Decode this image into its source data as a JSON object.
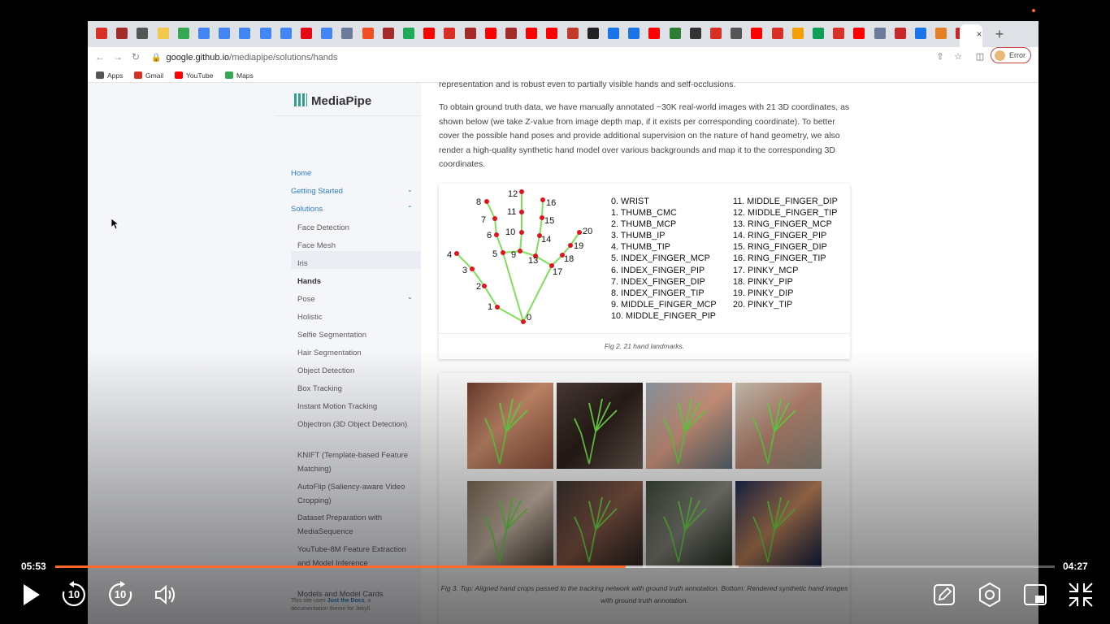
{
  "browser": {
    "tabs": [
      {
        "icon": "gmail-icon",
        "color": "#d93025"
      },
      {
        "icon": "bookmark-w-icon",
        "color": "#a52a2a"
      },
      {
        "icon": "circle-icon",
        "color": "#555555"
      },
      {
        "icon": "calendar-icon",
        "color": "#f2c94c"
      },
      {
        "icon": "drive-icon",
        "color": "#34a853"
      },
      {
        "icon": "docs-icon",
        "color": "#4285f4"
      },
      {
        "icon": "docs-icon",
        "color": "#4285f4"
      },
      {
        "icon": "docs-icon",
        "color": "#4285f4"
      },
      {
        "icon": "docs-icon",
        "color": "#4285f4"
      },
      {
        "icon": "docs-icon",
        "color": "#4285f4"
      },
      {
        "icon": "netflix-icon",
        "color": "#e50914"
      },
      {
        "icon": "docs-icon",
        "color": "#4285f4"
      },
      {
        "icon": "globe-icon",
        "color": "#6b7b9a"
      },
      {
        "icon": "windows-icon",
        "color": "#f25022"
      },
      {
        "icon": "bookmark-w-icon",
        "color": "#a52a2a"
      },
      {
        "icon": "app-icon",
        "color": "#1faa59"
      },
      {
        "icon": "youtube-icon",
        "color": "#ff0000"
      },
      {
        "icon": "mail-icon",
        "color": "#d93025"
      },
      {
        "icon": "bookmark-w-icon",
        "color": "#a52a2a"
      },
      {
        "icon": "youtube-icon",
        "color": "#ff0000"
      },
      {
        "icon": "bookmark-w-icon",
        "color": "#a52a2a"
      },
      {
        "icon": "youtube-icon",
        "color": "#ff0000"
      },
      {
        "icon": "youtube-icon",
        "color": "#ff0000"
      },
      {
        "icon": "person-icon",
        "color": "#c0392b"
      },
      {
        "icon": "github-icon",
        "color": "#222222"
      },
      {
        "icon": "k-icon",
        "color": "#1a73e8"
      },
      {
        "icon": "k-icon",
        "color": "#1a73e8"
      },
      {
        "icon": "youtube-icon",
        "color": "#ff0000"
      },
      {
        "icon": "app-icon",
        "color": "#2e7d32"
      },
      {
        "icon": "circle-icon",
        "color": "#333333"
      },
      {
        "icon": "mail-icon",
        "color": "#d93025"
      },
      {
        "icon": "cloud-icon",
        "color": "#555555"
      },
      {
        "icon": "youtube-icon",
        "color": "#ff0000"
      },
      {
        "icon": "mail-icon",
        "color": "#d93025"
      },
      {
        "icon": "link-icon",
        "color": "#f4a100"
      },
      {
        "icon": "sheet-icon",
        "color": "#0f9d58"
      },
      {
        "icon": "mail-icon",
        "color": "#d93025"
      },
      {
        "icon": "youtube-icon",
        "color": "#ff0000"
      },
      {
        "icon": "globe-icon",
        "color": "#6b7b9a"
      },
      {
        "icon": "k-red-icon",
        "color": "#c62828"
      },
      {
        "icon": "k-icon",
        "color": "#1a73e8"
      },
      {
        "icon": "pen-icon",
        "color": "#e67e22"
      },
      {
        "icon": "k-red-icon",
        "color": "#c62828"
      },
      {
        "icon": "page-icon",
        "color": "#ffffff"
      }
    ],
    "close_label": "×",
    "new_tab_label": "+",
    "url_host": "google.github.io",
    "url_path": "/mediapipe/solutions/hands",
    "error_label": "Error",
    "bookmarks": [
      {
        "label": "Apps",
        "icon": "apps-icon",
        "color": "#555555"
      },
      {
        "label": "Gmail",
        "icon": "gmail-icon",
        "color": "#d93025"
      },
      {
        "label": "YouTube",
        "icon": "youtube-icon",
        "color": "#ff0000"
      },
      {
        "label": "Maps",
        "icon": "maps-icon",
        "color": "#34a853"
      }
    ]
  },
  "sidebar": {
    "logo": "MediaPipe",
    "home": "Home",
    "getting_started": "Getting Started",
    "solutions": "Solutions",
    "items": [
      "Face Detection",
      "Face Mesh",
      "Iris",
      "Hands",
      "Pose",
      "Holistic",
      "Selfie Segmentation",
      "Hair Segmentation",
      "Object Detection",
      "Box Tracking",
      "Instant Motion Tracking",
      "Objectron (3D Object Detection)",
      "KNIFT (Template-based Feature Matching)",
      "AutoFlip (Saliency-aware Video Cropping)",
      "Dataset Preparation with MediaSequence",
      "YouTube-8M Feature Extraction and Model Inference",
      "Models and Model Cards"
    ],
    "footer_prefix": "This site uses ",
    "footer_link": "Just the Docs",
    "footer_suffix": ", a documentation theme for Jekyll."
  },
  "content": {
    "para1": "representation and is robust even to partially visible hands and self-occlusions.",
    "para2": "To obtain ground truth data, we have manually annotated ~30K real-world images with 21 3D coordinates, as shown below (we take Z-value from image depth map, if it exists per corresponding coordinate). To better cover the possible hand poses and provide additional supervision on the nature of hand geometry, we also render a high-quality synthetic hand model over various backgrounds and map it to the corresponding 3D coordinates.",
    "fig2_caption": "Fig 2. 21 hand landmarks.",
    "landmarks_col1": [
      "0. WRIST",
      "1. THUMB_CMC",
      "2. THUMB_MCP",
      "3. THUMB_IP",
      "4. THUMB_TIP",
      "5. INDEX_FINGER_MCP",
      "6. INDEX_FINGER_PIP",
      "7. INDEX_FINGER_DIP",
      "8. INDEX_FINGER_TIP",
      "9. MIDDLE_FINGER_MCP",
      "10. MIDDLE_FINGER_PIP"
    ],
    "landmarks_col2": [
      "11. MIDDLE_FINGER_DIP",
      "12. MIDDLE_FINGER_TIP",
      "13. RING_FINGER_MCP",
      "14. RING_FINGER_PIP",
      "15. RING_FINGER_DIP",
      "16. RING_FINGER_TIP",
      "17. PINKY_MCP",
      "18. PINKY_PIP",
      "19. PINKY_DIP",
      "20. PINKY_TIP"
    ],
    "fig3_caption": "Fig 3. Top: Aligned hand crops passed to the tracking network with ground truth annotation. Bottom: Rendered synthetic hand images with ground truth annotation."
  },
  "player": {
    "elapsed": "05:53",
    "remaining": "04:27",
    "progress_fraction": 0.571,
    "buffered_fraction": 0.684,
    "accent": "#ff6a2a",
    "rewind_label": "10",
    "forward_label": "10"
  }
}
